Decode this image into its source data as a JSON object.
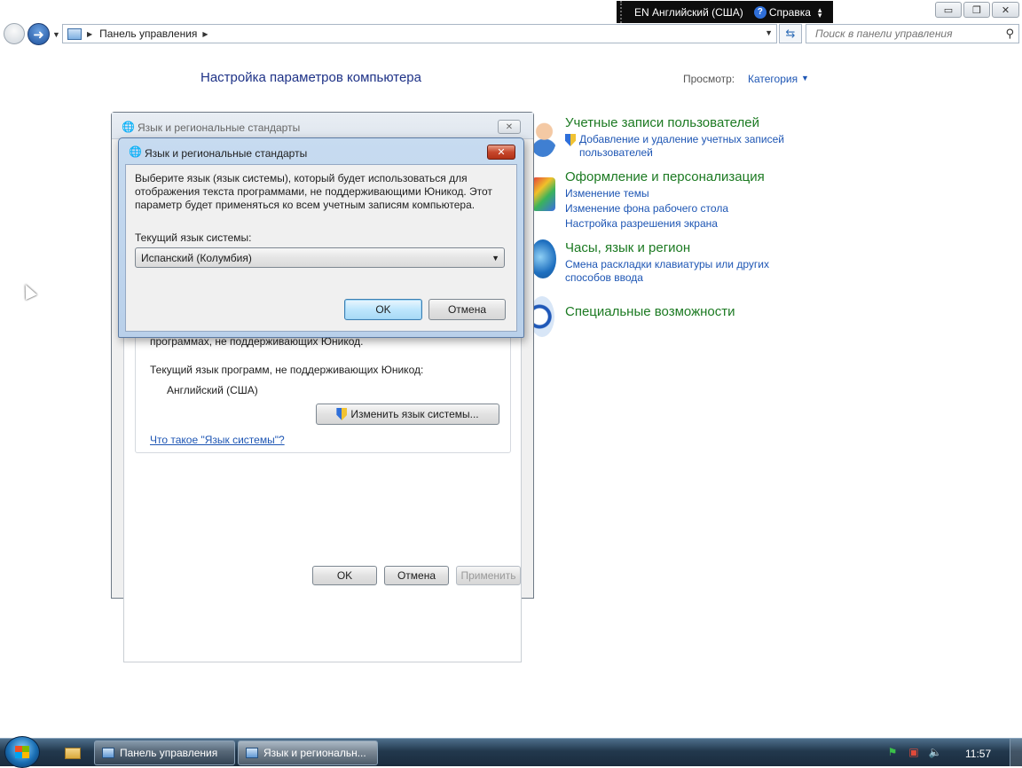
{
  "language_bar": {
    "language": "EN Английский (США)",
    "help": "Справка"
  },
  "window_controls": {
    "minimize": "▭",
    "maximize": "❐",
    "close": "✕"
  },
  "address_bar": {
    "breadcrumb": "Панель управления",
    "search_placeholder": "Поиск в панели управления"
  },
  "control_panel": {
    "title": "Настройка параметров компьютера",
    "view_by_label": "Просмотр:",
    "view_by_value": "Категория",
    "categories": [
      {
        "title": "Учетные записи пользователей",
        "links": [
          "Добавление и удаление учетных записей",
          "пользователей"
        ],
        "icon": "user-accounts-icon"
      },
      {
        "title": "Оформление и персонализация",
        "links": [
          "Изменение темы",
          "Изменение фона рабочего стола",
          "Настройка разрешения экрана"
        ],
        "icon": "appearance-icon"
      },
      {
        "title": "Часы, язык и регион",
        "links": [
          "Смена раскладки клавиатуры или других",
          "способов ввода"
        ],
        "icon": "globe-clock-icon"
      },
      {
        "title": "Специальные возможности",
        "links": [],
        "icon": "ease-of-access-icon"
      }
    ]
  },
  "back_dialog": {
    "title": "Язык и региональные стандарты",
    "partial_text": "программах, не поддерживающих Юникод.",
    "current_label": "Текущий язык программ, не поддерживающих Юникод:",
    "current_value": "Английский (США)",
    "change_button": "Изменить язык системы...",
    "what_link": "Что такое \"Язык системы\"?",
    "ok": "OK",
    "cancel": "Отмена",
    "apply": "Применить"
  },
  "front_dialog": {
    "title": "Язык и региональные стандарты",
    "description": "Выберите язык (язык системы), который будет использоваться для отображения текста программами, не поддерживающими Юникод. Этот параметр будет применяться ко всем учетным записям компьютера.",
    "label": "Текущий язык системы:",
    "selected_language": "Испанский (Колумбия)",
    "ok": "OK",
    "cancel": "Отмена"
  },
  "taskbar": {
    "tasks": [
      "Панель управления",
      "Язык и региональн..."
    ],
    "clock": "11:57"
  },
  "colors": {
    "link": "#1e56b4",
    "category_title": "#1c7a22",
    "page_title": "#1e3287"
  }
}
